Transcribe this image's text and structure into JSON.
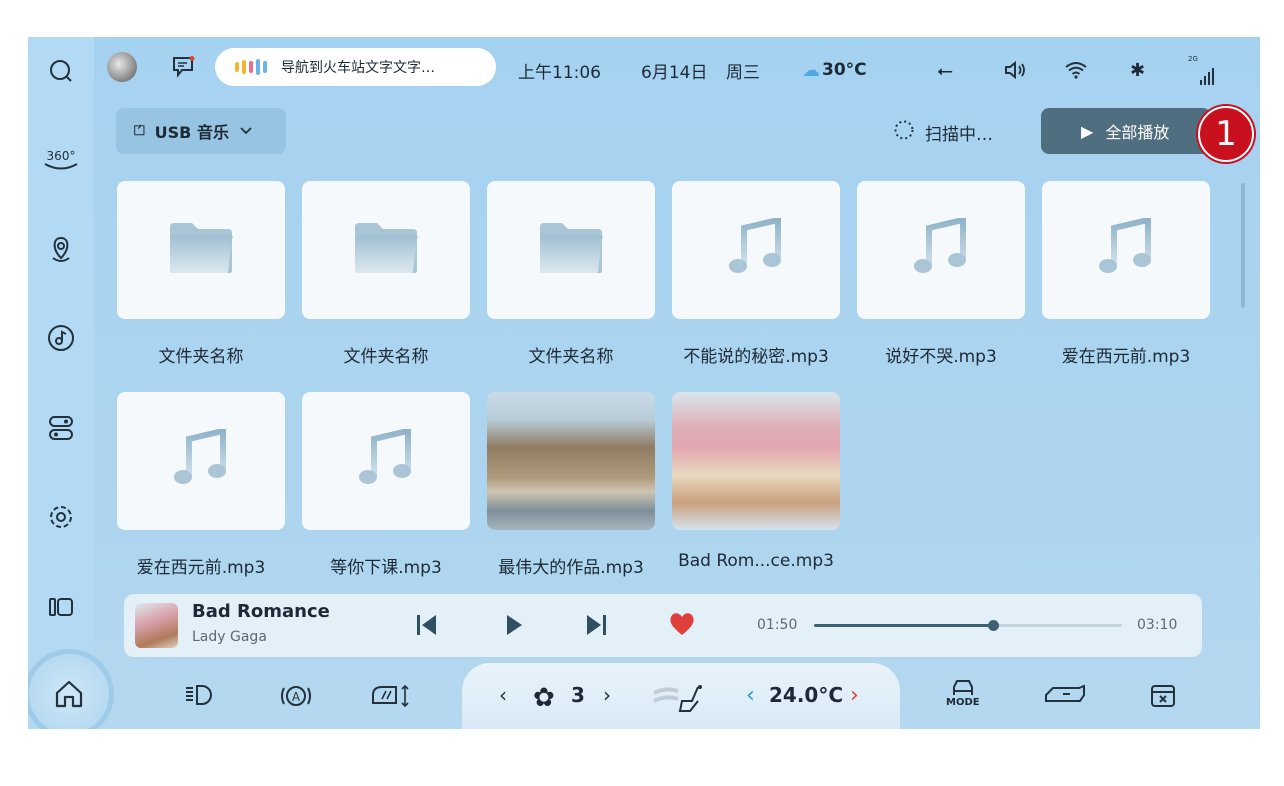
{
  "status_bar": {
    "voice_text": "导航到火车站文字文字…",
    "time": "上午11:06",
    "date": "6月14日",
    "weekday": "周三",
    "temperature": "30°C",
    "icons": [
      "usb-icon",
      "volume-icon",
      "wifi-icon",
      "bluetooth-icon",
      "signal-2g-icon"
    ],
    "signal_label": "2G"
  },
  "sidebar": {
    "items": [
      "search-icon",
      "360-view-icon",
      "navigation-icon",
      "music-icon",
      "toggle-settings-icon",
      "gear-icon",
      "split-view-icon",
      "home-icon"
    ],
    "label_360": "360°"
  },
  "toolbar": {
    "source": "USB 音乐",
    "scan_status": "扫描中…",
    "play_all": "全部播放",
    "annotation": "1"
  },
  "files": [
    {
      "name": "文件夹名称",
      "type": "folder"
    },
    {
      "name": "文件夹名称",
      "type": "folder"
    },
    {
      "name": "文件夹名称",
      "type": "folder"
    },
    {
      "name": "不能说的秘密.mp3",
      "type": "music"
    },
    {
      "name": "说好不哭.mp3",
      "type": "music"
    },
    {
      "name": "爱在西元前.mp3",
      "type": "music"
    },
    {
      "name": "爱在西元前.mp3",
      "type": "music"
    },
    {
      "name": "等你下课.mp3",
      "type": "music"
    },
    {
      "name": "最伟大的作品.mp3",
      "type": "photo-castle"
    },
    {
      "name": "Bad Rom...ce.mp3",
      "type": "photo-hat"
    }
  ],
  "player": {
    "title": "Bad Romance",
    "artist": "Lady Gaga",
    "elapsed": "01:50",
    "duration": "03:10",
    "progress": 0.58,
    "liked": true,
    "accent": "#3f6073",
    "heart_color": "#e0403c"
  },
  "climate": {
    "fan_level": "3",
    "temperature": "24.0°C",
    "mode_label": "MODE",
    "left_arrow_color": "#2a9bd8",
    "right_arrow_color": "#e0403c"
  }
}
